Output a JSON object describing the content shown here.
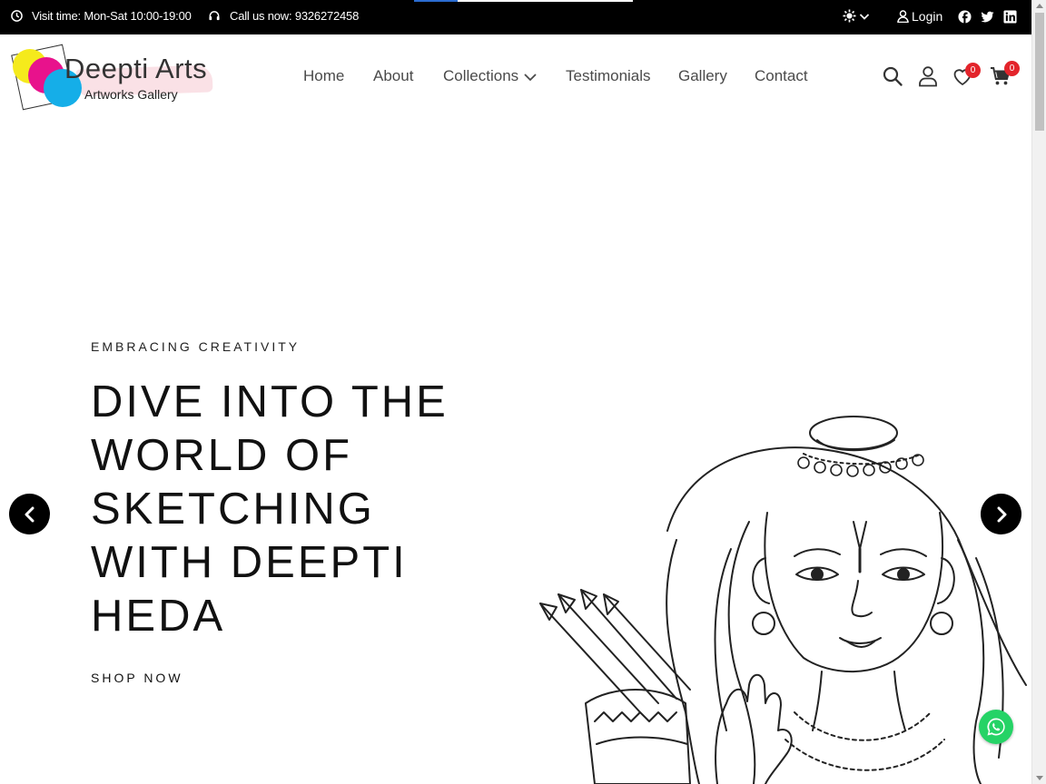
{
  "topbar": {
    "visit_time": "Visit time: Mon-Sat 10:00-19:00",
    "call": "Call us now: 9326272458",
    "login_label": "Login",
    "social": [
      "facebook-icon",
      "twitter-icon",
      "linkedin-icon"
    ]
  },
  "logo": {
    "title": "Deepti Arts",
    "subtitle": "Artworks Gallery",
    "colors": [
      "#f5ea1c",
      "#e8128c",
      "#15aee8"
    ]
  },
  "nav": {
    "items": [
      "Home",
      "About",
      "Collections",
      "Testimonials",
      "Gallery",
      "Contact"
    ]
  },
  "header_icons": {
    "wishlist_count": "0",
    "cart_count": "0"
  },
  "hero": {
    "eyebrow": "EMBRACING CREATIVITY",
    "headline": "DIVE INTO THE WORLD OF SKETCHING WITH DEEPTI HEDA",
    "cta": "SHOP NOW"
  },
  "colors": {
    "topbar_bg": "#000000",
    "badge": "#e3242b",
    "whatsapp": "#25d366"
  }
}
